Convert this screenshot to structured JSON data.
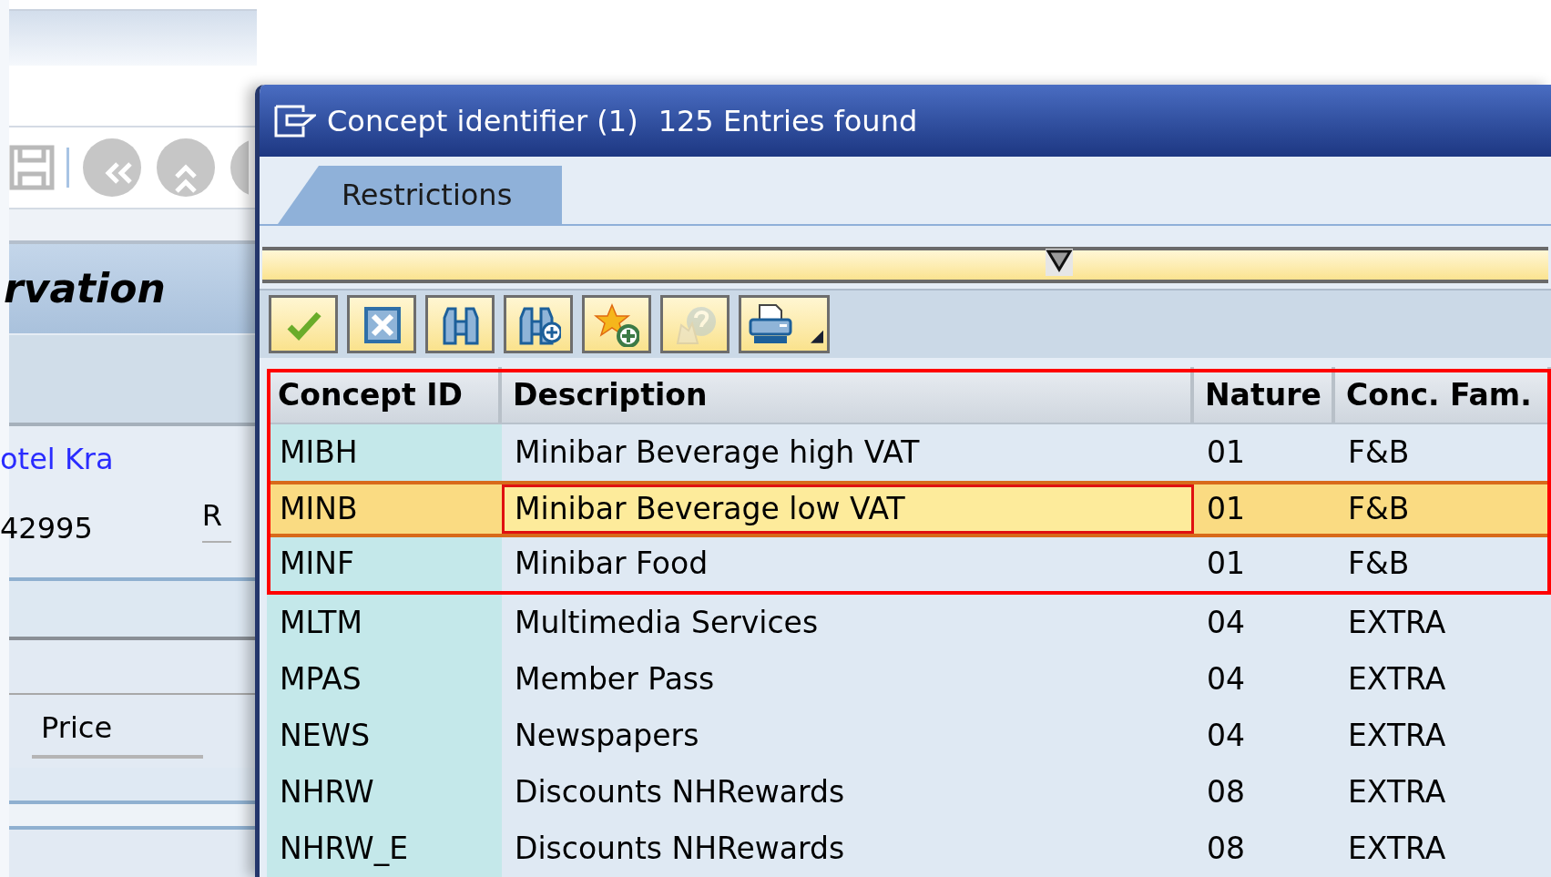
{
  "background_window": {
    "toolbar": [
      {
        "kind": "save"
      },
      {
        "kind": "back"
      },
      {
        "kind": "up"
      },
      {
        "kind": "round"
      }
    ],
    "title": "rvation",
    "link": "otel Kra",
    "number": "42995",
    "label_fragment": "R",
    "field_label": "Price"
  },
  "dialog": {
    "title": "Concept identifier (1)",
    "entries": "125 Entries found",
    "tabs": [
      {
        "label": "Restrictions",
        "selected": true
      }
    ],
    "toolbar": [
      {
        "kind": "accept",
        "disabled": false
      },
      {
        "kind": "cancel",
        "disabled": false
      },
      {
        "kind": "find",
        "disabled": false
      },
      {
        "kind": "find_more",
        "disabled": false
      },
      {
        "kind": "favorite_add",
        "disabled": false
      },
      {
        "kind": "help",
        "disabled": true
      },
      {
        "kind": "print",
        "disabled": false
      }
    ],
    "table": {
      "columns": [
        "Concept ID",
        "Description",
        "Nature",
        "Conc. Fam."
      ],
      "rows": [
        {
          "cells": [
            "MIBH",
            "Minibar Beverage high VAT",
            "01",
            "F&B"
          ],
          "selected": false
        },
        {
          "cells": [
            "MINB",
            "Minibar Beverage low VAT",
            "01",
            "F&B"
          ],
          "selected": true
        },
        {
          "cells": [
            "MINF",
            "Minibar Food",
            "01",
            "F&B"
          ],
          "selected": false
        },
        {
          "cells": [
            "MLTM",
            "Multimedia Services",
            "04",
            "EXTRA"
          ],
          "selected": false
        },
        {
          "cells": [
            "MPAS",
            "Member Pass",
            "04",
            "EXTRA"
          ],
          "selected": false
        },
        {
          "cells": [
            "NEWS",
            "Newspapers",
            "04",
            "EXTRA"
          ],
          "selected": false
        },
        {
          "cells": [
            "NHRW",
            "Discounts NHRewards",
            "08",
            "EXTRA"
          ],
          "selected": false
        },
        {
          "cells": [
            "NHRW_E",
            "Discounts NHRewards",
            "08",
            "EXTRA"
          ],
          "selected": false
        }
      ]
    }
  }
}
